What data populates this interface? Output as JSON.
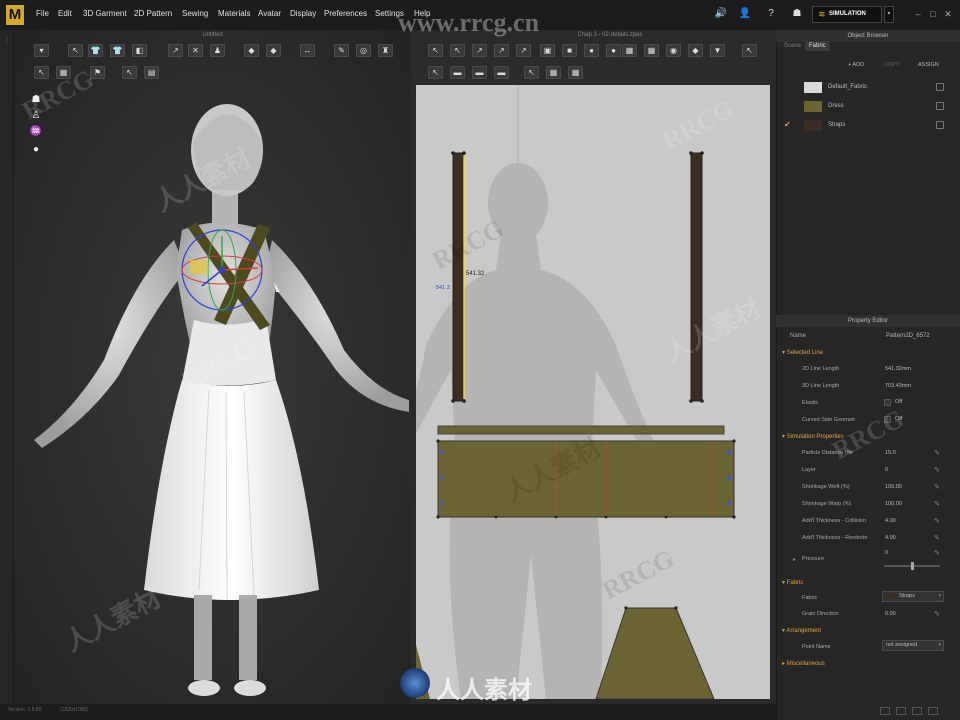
{
  "app": {
    "logo": "M"
  },
  "menu": [
    "File",
    "Edit",
    "3D Garment",
    "2D Pattern",
    "Sewing",
    "Materials",
    "Avatar",
    "Display",
    "Preferences",
    "Settings",
    "Help"
  ],
  "simulation_label": "SIMULATION",
  "viewport3d": {
    "title": "Untitled"
  },
  "viewport2d": {
    "title": "Chap 3 - 02-details.zpac",
    "measure_label": "541.32",
    "measure_label_2": "541.3"
  },
  "object_browser": {
    "title": "Object Browser",
    "tabs": [
      "Scene",
      "Fabric"
    ],
    "actions": [
      "+ ADD",
      "COPY",
      "ASSIGN"
    ],
    "items": [
      {
        "name": "Default_Fabric",
        "color": "#d9d9d9"
      },
      {
        "name": "Dress",
        "color": "#6b6533"
      },
      {
        "name": "Straps",
        "color": "#3a2e22"
      }
    ]
  },
  "property_editor": {
    "title": "Property Editor",
    "name_label": "Name",
    "name_value": "Pattern2D_6572",
    "sections": {
      "selected_line": "Selected Line",
      "simulation": "Simulation Properties",
      "fabric": "Fabric",
      "arrangement": "Arrangement",
      "misc": "Miscellaneous"
    },
    "rows": {
      "line_length_2d": {
        "label": "2D Line Length",
        "value": "541.32mm"
      },
      "line_length_3d": {
        "label": "3D Line Length",
        "value": "703.43mm"
      },
      "elastic": {
        "label": "Elastic",
        "value": "Off"
      },
      "curved": {
        "label": "Curved Side Geometr",
        "value": "Off"
      },
      "particle": {
        "label": "Particle Distance (mr",
        "value": "15.0"
      },
      "layer": {
        "label": "Layer",
        "value": "0"
      },
      "weft": {
        "label": "Shrinkage Weft (%)",
        "value": "100.00"
      },
      "warp": {
        "label": "Shrinkage Warp (%)",
        "value": "100.00"
      },
      "collision": {
        "label": "Add'l Thickness - Collision",
        "value": "4.00"
      },
      "rendering": {
        "label": "Add'l Thickness - Renderin",
        "value": "4.00"
      },
      "pressure": {
        "label": "Pressure",
        "value": "0"
      },
      "fabric": {
        "label": "Fabric",
        "value": "Straps"
      },
      "grain": {
        "label": "Grain Direction",
        "value": "0.00"
      },
      "point_name": {
        "label": "Point Name",
        "value": "not assigned"
      }
    }
  },
  "status": {
    "left": "Version: 2.5.86",
    "mid": "(1920x1080)"
  },
  "watermark": {
    "text": "www.rrcg.cn",
    "brand": "RRCG",
    "cn": "人人素材"
  },
  "colors": {
    "accent": "#e3a23b",
    "pattern": "#6b6533",
    "strap": "#3a2e22"
  }
}
